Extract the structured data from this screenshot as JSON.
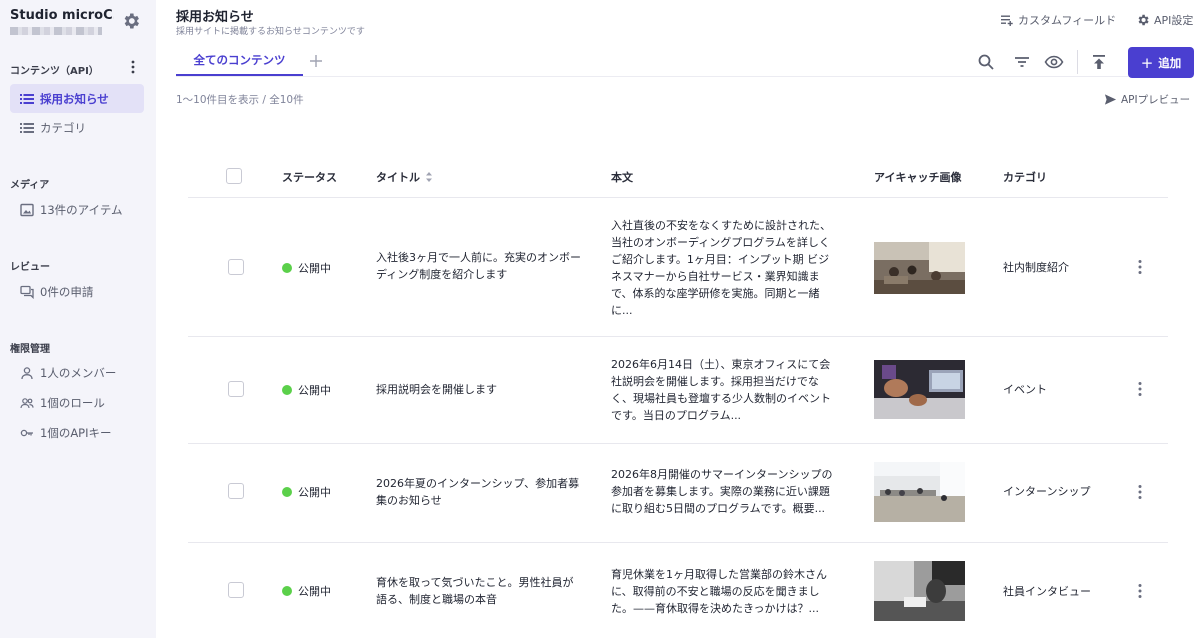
{
  "sidebar": {
    "brand_name": "Studio microC...",
    "section_content": "コンテンツ（API）",
    "items_content": [
      {
        "label": "採用お知らせ"
      },
      {
        "label": "カテゴリ"
      }
    ],
    "section_media": "メディア",
    "media_item": "13件のアイテム",
    "section_review": "レビュー",
    "review_item": "0件の申請",
    "section_permissions": "権限管理",
    "permission_items": [
      {
        "label": "1人のメンバー"
      },
      {
        "label": "1個のロール"
      },
      {
        "label": "1個のAPIキー"
      }
    ]
  },
  "header": {
    "title": "採用お知らせ",
    "description": "採用サイトに掲載するお知らせコンテンツです",
    "custom_fields": "カスタムフィールド",
    "api_settings": "API設定"
  },
  "tabs": {
    "active": "全てのコンテンツ"
  },
  "toolbar": {
    "add_label": "追加",
    "add_symbol": "+"
  },
  "list": {
    "count_text": "1〜10件目を表示 / 全10件",
    "api_preview": "APIプレビュー",
    "columns": {
      "status": "ステータス",
      "title": "タイトル",
      "body": "本文",
      "image": "アイキャッチ画像",
      "category": "カテゴリ"
    },
    "rows": [
      {
        "status": "公開中",
        "title": "入社後3ヶ月で一人前に。充実のオンボーディング制度を紹介します",
        "body": "入社直後の不安をなくすために設計された、当社のオンボーディングプログラムを詳しくご紹介します。1ヶ月目：インプット期 ビジネスマナーから自社サービス・業界知識まで、体系的な座学研修を実施。同期と一緒に...",
        "category": "社内制度紹介"
      },
      {
        "status": "公開中",
        "title": "採用説明会を開催します",
        "body": "2026年6月14日（土）、東京オフィスにて会社説明会を開催します。採用担当だけでなく、現場社員も登壇する少人数制のイベントです。当日のプログラム...",
        "category": "イベント"
      },
      {
        "status": "公開中",
        "title": "2026年夏のインターンシップ、参加者募集のお知らせ",
        "body": "2026年8月開催のサマーインターンシップの参加者を募集します。実際の業務に近い課題に取り組む5日間のプログラムです。概要...",
        "category": "インターンシップ"
      },
      {
        "status": "公開中",
        "title": "育休を取って気づいたこと。男性社員が語る、制度と職場の本音",
        "body": "育児休業を1ヶ月取得した営業部の鈴木さんに、取得前の不安と職場の反応を聞きました。——育休取得を決めたきっかけは？...",
        "category": "社員インタビュー"
      }
    ]
  },
  "colors": {
    "accent": "#4a3fd0",
    "sidebar_bg": "#f4f4fa",
    "status_published": "#5bd04a"
  }
}
